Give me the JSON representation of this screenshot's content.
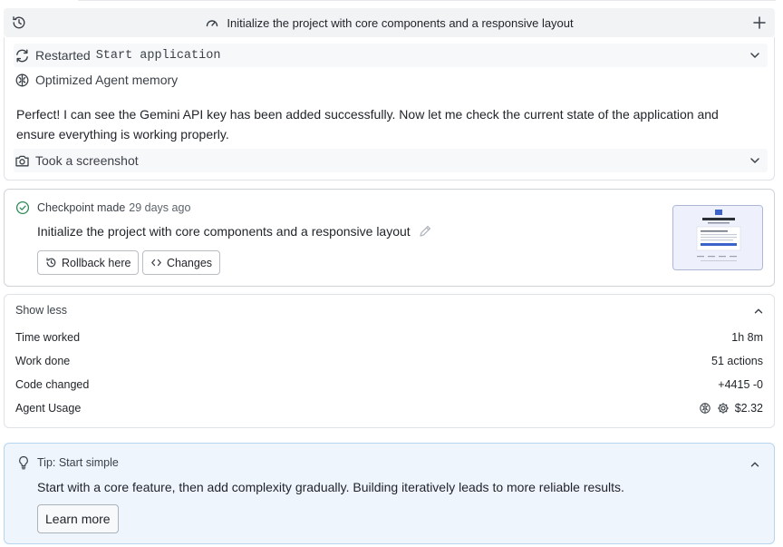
{
  "header": {
    "title": "Initialize the project with core components and a responsive layout"
  },
  "activity": {
    "restarted_label": "Restarted",
    "restarted_target": "Start application",
    "optimized_label": "Optimized Agent memory",
    "message": "Perfect! I can see the Gemini API key has been added successfully. Now let me check the current state of the application and ensure everything is working properly.",
    "screenshot_label": "Took a screenshot"
  },
  "checkpoint": {
    "label": "Checkpoint made",
    "age": "29 days ago",
    "title": "Initialize the project with core components and a responsive layout",
    "rollback_label": "Rollback here",
    "changes_label": "Changes"
  },
  "stats": {
    "toggle_label": "Show less",
    "rows": [
      {
        "label": "Time worked",
        "value": "1h 8m"
      },
      {
        "label": "Work done",
        "value": "51 actions"
      },
      {
        "label": "Code changed",
        "value": "+4415 -0"
      },
      {
        "label": "Agent Usage",
        "value": "$2.32"
      }
    ]
  },
  "tip": {
    "title": "Tip: Start simple",
    "text": "Start with a core feature, then add complexity gradually. Building iteratively leads to more reliable results.",
    "learn_label": "Learn more"
  },
  "colors": {
    "success": "#2e8b57",
    "tip_bg": "#eef5fd",
    "tip_border": "#b8d5ef"
  }
}
